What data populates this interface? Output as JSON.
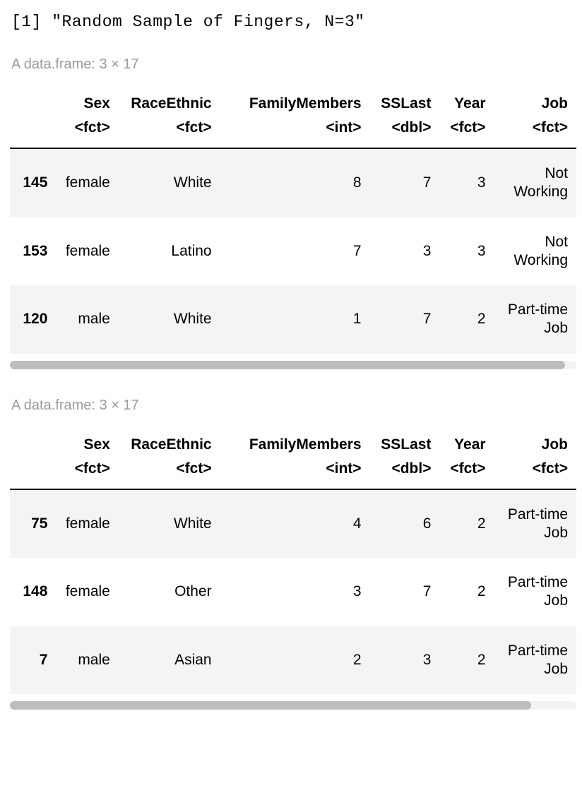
{
  "console_output": "[1] \"Random Sample of Fingers, N=3\"",
  "frame_caption": "A data.frame: 3 × 17",
  "columns": {
    "sex": {
      "label": "Sex",
      "type": "<fct>"
    },
    "race": {
      "label": "RaceEthnic",
      "type": "<fct>"
    },
    "family": {
      "label": "FamilyMembers",
      "type": "<int>"
    },
    "sslast": {
      "label": "SSLast",
      "type": "<dbl>"
    },
    "year": {
      "label": "Year",
      "type": "<fct>"
    },
    "job": {
      "label": "Job",
      "type": "<fct>"
    }
  },
  "table1": {
    "thumb_width": "98%",
    "rows": [
      {
        "rn": "145",
        "sex": "female",
        "race": "White",
        "family": "8",
        "sslast": "7",
        "year": "3",
        "job": "Not Working"
      },
      {
        "rn": "153",
        "sex": "female",
        "race": "Latino",
        "family": "7",
        "sslast": "3",
        "year": "3",
        "job": "Not Working"
      },
      {
        "rn": "120",
        "sex": "male",
        "race": "White",
        "family": "1",
        "sslast": "7",
        "year": "2",
        "job": "Part-time Job"
      }
    ]
  },
  "table2": {
    "thumb_width": "92%",
    "rows": [
      {
        "rn": "75",
        "sex": "female",
        "race": "White",
        "family": "4",
        "sslast": "6",
        "year": "2",
        "job": "Part-time Job"
      },
      {
        "rn": "148",
        "sex": "female",
        "race": "Other",
        "family": "3",
        "sslast": "7",
        "year": "2",
        "job": "Part-time Job"
      },
      {
        "rn": "7",
        "sex": "male",
        "race": "Asian",
        "family": "2",
        "sslast": "3",
        "year": "2",
        "job": "Part-time Job"
      }
    ]
  }
}
